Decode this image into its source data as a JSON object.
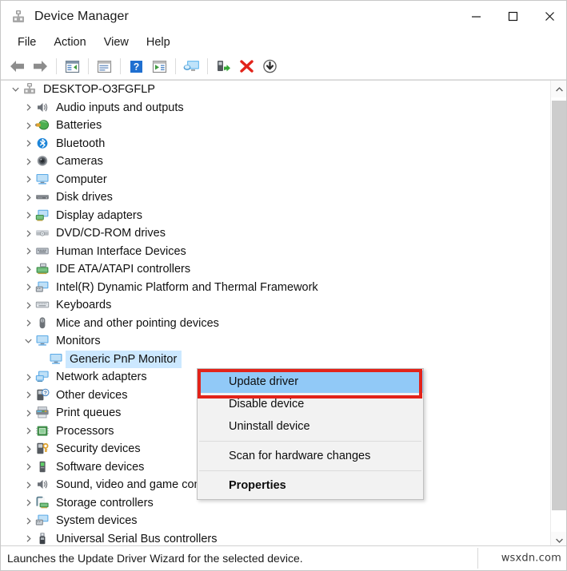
{
  "window": {
    "title": "Device Manager",
    "icon": "device-manager-icon",
    "controls": {
      "minimize": "—",
      "maximize": "□",
      "close": "✕"
    }
  },
  "menubar": {
    "items": [
      {
        "label": "File"
      },
      {
        "label": "Action"
      },
      {
        "label": "View"
      },
      {
        "label": "Help"
      }
    ]
  },
  "toolbar": {
    "buttons": [
      {
        "name": "back-arrow-icon",
        "tip": "Back"
      },
      {
        "name": "forward-arrow-icon",
        "tip": "Forward"
      },
      {
        "name": "show-hide-console-tree-icon",
        "tip": "Show/Hide Console Tree"
      },
      {
        "name": "properties-icon",
        "tip": "Properties"
      },
      {
        "name": "help-icon",
        "tip": "Help"
      },
      {
        "name": "update-driver-icon",
        "tip": "Update driver"
      },
      {
        "name": "scan-hardware-changes-icon",
        "tip": "Scan for hardware changes"
      },
      {
        "name": "enable-device-icon",
        "tip": "Enable device"
      },
      {
        "name": "uninstall-device-icon",
        "tip": "Uninstall device"
      },
      {
        "name": "disable-device-icon",
        "tip": "Disable device"
      }
    ]
  },
  "tree": {
    "root": {
      "label": "DESKTOP-O3FGFLP",
      "expanded": true,
      "icon": "computer-root-icon"
    },
    "items": [
      {
        "label": "Audio inputs and outputs",
        "icon": "speaker-icon",
        "expanded": false,
        "selected": false
      },
      {
        "label": "Batteries",
        "icon": "battery-icon",
        "expanded": false,
        "selected": false
      },
      {
        "label": "Bluetooth",
        "icon": "bluetooth-icon",
        "expanded": false,
        "selected": false
      },
      {
        "label": "Cameras",
        "icon": "camera-icon",
        "expanded": false,
        "selected": false
      },
      {
        "label": "Computer",
        "icon": "monitor-icon",
        "expanded": false,
        "selected": false
      },
      {
        "label": "Disk drives",
        "icon": "disk-drive-icon",
        "expanded": false,
        "selected": false
      },
      {
        "label": "Display adapters",
        "icon": "display-adapter-icon",
        "expanded": false,
        "selected": false
      },
      {
        "label": "DVD/CD-ROM drives",
        "icon": "optical-drive-icon",
        "expanded": false,
        "selected": false
      },
      {
        "label": "Human Interface Devices",
        "icon": "hid-icon",
        "expanded": false,
        "selected": false
      },
      {
        "label": "IDE ATA/ATAPI controllers",
        "icon": "ide-controller-icon",
        "expanded": false,
        "selected": false
      },
      {
        "label": "Intel(R) Dynamic Platform and Thermal Framework",
        "icon": "system-device-icon",
        "expanded": false,
        "selected": false
      },
      {
        "label": "Keyboards",
        "icon": "keyboard-icon",
        "expanded": false,
        "selected": false
      },
      {
        "label": "Mice and other pointing devices",
        "icon": "mouse-icon",
        "expanded": false,
        "selected": false
      },
      {
        "label": "Monitors",
        "icon": "monitor-icon",
        "expanded": true,
        "selected": false
      },
      {
        "label": "Generic PnP Monitor",
        "icon": "monitor-icon",
        "child": true,
        "selected": true
      },
      {
        "label": "Network adapters",
        "icon": "network-adapter-icon",
        "expanded": false,
        "selected": false
      },
      {
        "label": "Other devices",
        "icon": "other-device-icon",
        "expanded": false,
        "selected": false
      },
      {
        "label": "Print queues",
        "icon": "printer-icon",
        "expanded": false,
        "selected": false
      },
      {
        "label": "Processors",
        "icon": "processor-icon",
        "expanded": false,
        "selected": false
      },
      {
        "label": "Security devices",
        "icon": "security-device-icon",
        "expanded": false,
        "selected": false
      },
      {
        "label": "Software devices",
        "icon": "software-device-icon",
        "expanded": false,
        "selected": false
      },
      {
        "label": "Sound, video and game controllers",
        "icon": "speaker-icon",
        "expanded": false,
        "selected": false
      },
      {
        "label": "Storage controllers",
        "icon": "storage-controller-icon",
        "expanded": false,
        "selected": false
      },
      {
        "label": "System devices",
        "icon": "system-device-icon",
        "expanded": false,
        "selected": false
      },
      {
        "label": "Universal Serial Bus controllers",
        "icon": "usb-icon",
        "expanded": false,
        "selected": false
      }
    ]
  },
  "context_menu": {
    "items": [
      {
        "label": "Update driver",
        "highlighted": true,
        "bold": false
      },
      {
        "label": "Disable device",
        "highlighted": false,
        "bold": false
      },
      {
        "label": "Uninstall device",
        "highlighted": false,
        "bold": false
      },
      {
        "separator": true
      },
      {
        "label": "Scan for hardware changes",
        "highlighted": false,
        "bold": false
      },
      {
        "separator": true
      },
      {
        "label": "Properties",
        "highlighted": false,
        "bold": true
      }
    ]
  },
  "highlight": {
    "color": "#e2231a",
    "target": "Update driver"
  },
  "statusbar": {
    "text": "Launches the Update Driver Wizard for the selected device.",
    "watermark": "wsxdn.com"
  },
  "colors": {
    "selection": "#cce8ff",
    "menu_highlight": "#91c9f7",
    "annotation_red": "#e2231a",
    "window_bg": "#ffffff"
  }
}
